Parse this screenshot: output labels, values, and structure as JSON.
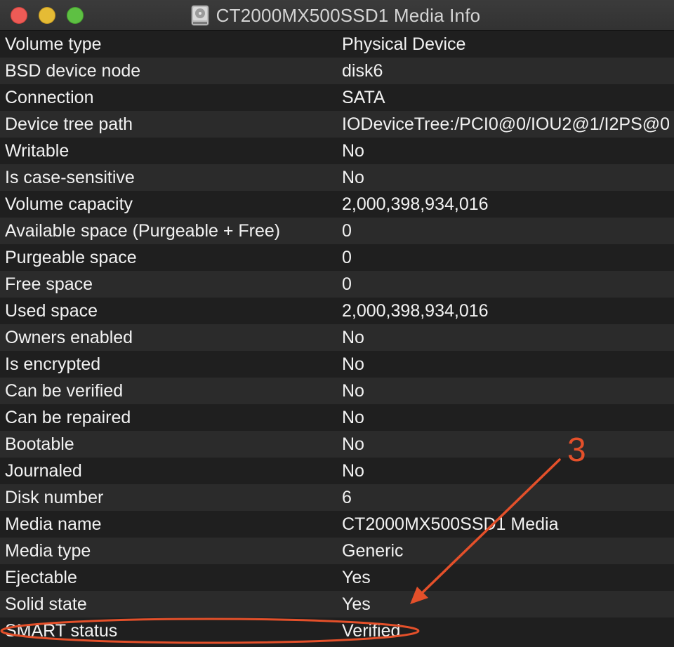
{
  "window": {
    "title": "CT2000MX500SSD1 Media Info",
    "title_icon": "disk-drive-icon"
  },
  "rows": [
    {
      "label": "Volume type",
      "value": "Physical Device"
    },
    {
      "label": "BSD device node",
      "value": "disk6"
    },
    {
      "label": "Connection",
      "value": "SATA"
    },
    {
      "label": "Device tree path",
      "value": "IODeviceTree:/PCI0@0/IOU2@1/I2PS@0"
    },
    {
      "label": "Writable",
      "value": "No"
    },
    {
      "label": "Is case-sensitive",
      "value": "No"
    },
    {
      "label": "Volume capacity",
      "value": "2,000,398,934,016"
    },
    {
      "label": "Available space (Purgeable + Free)",
      "value": "0"
    },
    {
      "label": "Purgeable space",
      "value": "0"
    },
    {
      "label": "Free space",
      "value": "0"
    },
    {
      "label": "Used space",
      "value": "2,000,398,934,016"
    },
    {
      "label": "Owners enabled",
      "value": "No"
    },
    {
      "label": "Is encrypted",
      "value": "No"
    },
    {
      "label": "Can be verified",
      "value": "No"
    },
    {
      "label": "Can be repaired",
      "value": "No"
    },
    {
      "label": "Bootable",
      "value": "No"
    },
    {
      "label": "Journaled",
      "value": "No"
    },
    {
      "label": "Disk number",
      "value": "6"
    },
    {
      "label": "Media name",
      "value": "CT2000MX500SSD1 Media"
    },
    {
      "label": "Media type",
      "value": "Generic"
    },
    {
      "label": "Ejectable",
      "value": "Yes"
    },
    {
      "label": "Solid state",
      "value": "Yes"
    },
    {
      "label": "SMART status",
      "value": "Verified"
    }
  ],
  "annotation": {
    "number": "3",
    "color": "#e4502a"
  },
  "colors": {
    "row_odd": "#1f1f1f",
    "row_even": "#2b2b2b",
    "text": "#f2f2f2",
    "close": "#ee5b56",
    "minimize": "#e5bb35",
    "zoom": "#5ec043"
  }
}
